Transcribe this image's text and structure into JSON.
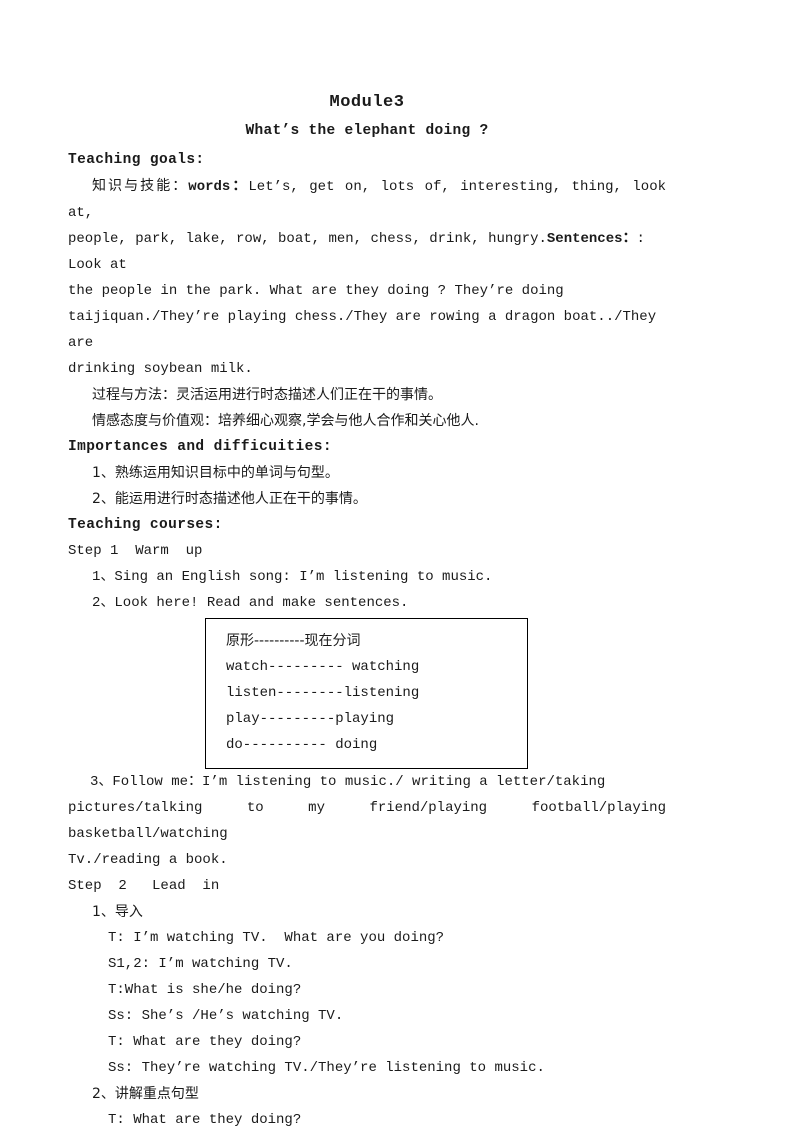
{
  "document": {
    "title": "Module3",
    "subtitle": "What’s  the elephant  doing ?",
    "sections": {
      "teaching_goals_heading": "Teaching  goals:",
      "knowledge_label": "知识与技能：",
      "words_label": "words：",
      "words_line1": "Let’s, get on, lots of, interesting, thing, look at,",
      "words_line2": "people, park, lake, row, boat, men, chess, drink, hungry.",
      "sentences_label": "Sentences：",
      "sentences_colon": ":",
      "sentences_line1": " Look at",
      "sentences_line2": "the people in the park. What are they doing ? They’re doing",
      "sentences_line3": "taijiquan./They’re playing chess./They are rowing a dragon boat../They are",
      "sentences_line4": "drinking soybean milk.",
      "process_method": "过程与方法：灵活运用进行时态描述人们正在干的事情。",
      "attitude_values": "情感态度与价值观：培养细心观察,学会与他人合作和关心他人.",
      "importances_heading": "Importances  and  difficuities:",
      "importance_1": "1、熟练运用知识目标中的单词与句型。",
      "importance_2": "2、能运用进行时态描述他人正在干的事情。",
      "courses_heading": "Teaching  courses:",
      "step1": "Step 1  Warm  up",
      "step1_item1": "1、Sing an English song: I’m listening to music.",
      "step1_item2": "2、Look here! Read and make sentences."
    },
    "verb_box": {
      "rows": [
        "原形----------现在分词",
        "watch--------- watching",
        "listen--------listening",
        "play---------playing",
        "do---------- doing"
      ]
    },
    "follow_me": {
      "line1": "3、Follow me：I’m listening to music./ writing a letter/taking",
      "line2": "pictures/talking to my friend/playing football/playing basketball/watching",
      "line3": "Tv./reading a book."
    },
    "step2": {
      "heading": "Step  2   Lead  in",
      "item1": "1、导入",
      "dialogue": [
        "T: I’m watching TV.  What are you doing?",
        "S1,2: I’m watching TV.",
        "T:What is she/he doing?",
        "Ss: She’s /He’s watching TV.",
        "T: What are they doing?",
        "Ss: They’re watching TV./They’re listening to music."
      ],
      "item2": "2、讲解重点句型",
      "dialogue2": [
        "T: What are they doing?"
      ]
    }
  }
}
